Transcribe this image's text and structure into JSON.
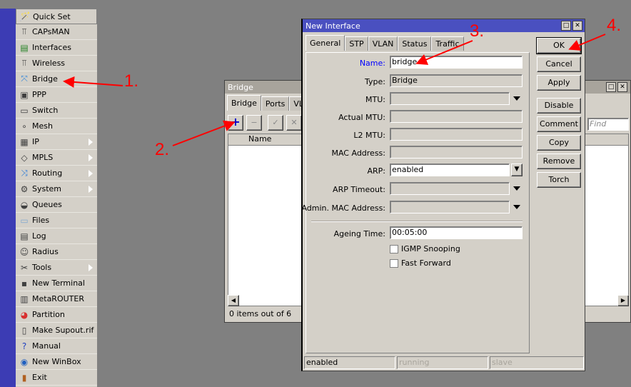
{
  "menu": {
    "items": [
      {
        "label": "Quick Set",
        "icon": "wand-icon",
        "submenu": false
      },
      {
        "label": "CAPsMAN",
        "icon": "antenna-icon",
        "submenu": false
      },
      {
        "label": "Interfaces",
        "icon": "network-card-icon",
        "submenu": false
      },
      {
        "label": "Wireless",
        "icon": "antenna-icon",
        "submenu": false
      },
      {
        "label": "Bridge",
        "icon": "bridge-icon",
        "submenu": false
      },
      {
        "label": "PPP",
        "icon": "ppp-icon",
        "submenu": false
      },
      {
        "label": "Switch",
        "icon": "switch-icon",
        "submenu": false
      },
      {
        "label": "Mesh",
        "icon": "mesh-icon",
        "submenu": false
      },
      {
        "label": "IP",
        "icon": "ip-icon",
        "submenu": true
      },
      {
        "label": "MPLS",
        "icon": "tags-icon",
        "submenu": true
      },
      {
        "label": "Routing",
        "icon": "routing-icon",
        "submenu": true
      },
      {
        "label": "System",
        "icon": "gear-icon",
        "submenu": true
      },
      {
        "label": "Queues",
        "icon": "gauge-icon",
        "submenu": false
      },
      {
        "label": "Files",
        "icon": "folder-icon",
        "submenu": false
      },
      {
        "label": "Log",
        "icon": "log-icon",
        "submenu": false
      },
      {
        "label": "Radius",
        "icon": "users-icon",
        "submenu": false
      },
      {
        "label": "Tools",
        "icon": "tools-icon",
        "submenu": true
      },
      {
        "label": "New Terminal",
        "icon": "terminal-icon",
        "submenu": false
      },
      {
        "label": "MetaROUTER",
        "icon": "metarouter-icon",
        "submenu": false
      },
      {
        "label": "Partition",
        "icon": "pie-icon",
        "submenu": false
      },
      {
        "label": "Make Supout.rif",
        "icon": "document-icon",
        "submenu": false
      },
      {
        "label": "Manual",
        "icon": "help-icon",
        "submenu": false
      },
      {
        "label": "New WinBox",
        "icon": "winbox-icon",
        "submenu": false
      },
      {
        "label": "Exit",
        "icon": "exit-door-icon",
        "submenu": false
      }
    ]
  },
  "bridge_window": {
    "title": "Bridge",
    "tabs": [
      "Bridge",
      "Ports",
      "VLAN"
    ],
    "find_placeholder": "Find",
    "column_name": "Name",
    "status": "0 items out of 6"
  },
  "new_interface": {
    "title": "New Interface",
    "tabs": [
      "General",
      "STP",
      "VLAN",
      "Status",
      "Traffic"
    ],
    "fields": {
      "name": {
        "label": "Name:",
        "value": "bridge"
      },
      "type": {
        "label": "Type:",
        "value": "Bridge"
      },
      "mtu": {
        "label": "MTU:",
        "value": ""
      },
      "actual_mtu": {
        "label": "Actual MTU:",
        "value": ""
      },
      "l2_mtu": {
        "label": "L2 MTU:",
        "value": ""
      },
      "mac": {
        "label": "MAC Address:",
        "value": ""
      },
      "arp": {
        "label": "ARP:",
        "value": "enabled"
      },
      "arp_timeout": {
        "label": "ARP Timeout:",
        "value": ""
      },
      "admin_mac": {
        "label": "Admin. MAC Address:",
        "value": ""
      },
      "ageing": {
        "label": "Ageing Time:",
        "value": "00:05:00"
      }
    },
    "igmp_label": "IGMP Snooping",
    "fast_forward_label": "Fast Forward",
    "buttons": [
      "OK",
      "Cancel",
      "Apply",
      "Disable",
      "Comment",
      "Copy",
      "Remove",
      "Torch"
    ],
    "status": [
      "enabled",
      "running",
      "slave"
    ]
  },
  "annotations": [
    "1.",
    "2.",
    "3.",
    "4."
  ],
  "colors": {
    "accent": "#ff0000",
    "title_active": "#4a50c0",
    "name_label": "#0000ff"
  }
}
